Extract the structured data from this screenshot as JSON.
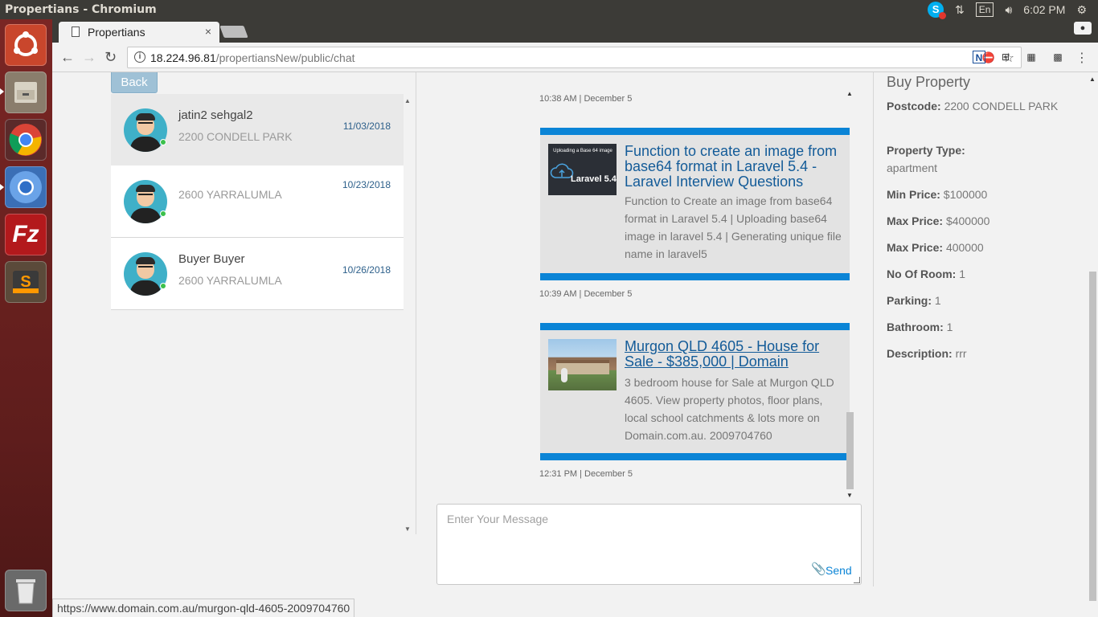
{
  "os": {
    "window_title": "Propertians - Chromium",
    "lang": "En",
    "clock": "6:02 PM",
    "skype_letter": "S"
  },
  "browser": {
    "tab_title": "Propertians",
    "tab_close": "×",
    "url_host": "18.224.96.81",
    "url_path": "/propertiansNew/public/chat",
    "status_url": "https://www.domain.com.au/murgon-qld-4605-2009704760"
  },
  "icons": {
    "back": "←",
    "forward": "→",
    "reload": "↻",
    "star": "☆",
    "menu": "⋮",
    "clip": "📎"
  },
  "sidebar": {
    "back_label": "Back",
    "contacts": [
      {
        "name": "jatin2 sehgal2",
        "location": "2200 CONDELL PARK",
        "date": "11/03/2018",
        "active": true
      },
      {
        "name": "",
        "location": "2600 YARRALUMLA",
        "date": "10/23/2018",
        "active": false
      },
      {
        "name": "Buyer Buyer",
        "location": "2600 YARRALUMLA",
        "date": "10/26/2018",
        "active": false
      }
    ]
  },
  "chat": {
    "messages": [
      {
        "time": "10:38 AM | December 5"
      },
      {
        "time": "10:39 AM | December 5",
        "card": {
          "thumb_line1": "Uploading a Base 64 image",
          "thumb_line2": "Laravel 5.4",
          "title": "Function to create an image from base64 format in Laravel 5.4 - Laravel Interview Questions",
          "description": "Function to Create an image from base64 format in Laravel 5.4 | Uploading base64 image in laravel 5.4 | Generating unique file name in laravel5"
        }
      },
      {
        "time": "12:31 PM | December 5",
        "card": {
          "title": "Murgon QLD 4605 - House for Sale - $385,000 | Domain",
          "description": "3 bedroom house for Sale at Murgon QLD 4605. View property photos, floor plans, local school catchments & lots more on Domain.com.au. 2009704760"
        }
      }
    ],
    "composer_placeholder": "Enter Your Message",
    "send_label": "Send"
  },
  "property": {
    "heading": "Buy Property",
    "rows": [
      {
        "label": "Postcode:",
        "value": "2200 CONDELL PARK"
      },
      {
        "label": "Property Type:",
        "value": "apartment"
      },
      {
        "label": "Min Price:",
        "value": "$100000"
      },
      {
        "label": "Max Price:",
        "value": "$400000"
      },
      {
        "label": "Max Price:",
        "value": "400000"
      },
      {
        "label": "No Of Room:",
        "value": "1"
      },
      {
        "label": "Parking:",
        "value": "1"
      },
      {
        "label": "Bathroom:",
        "value": "1"
      },
      {
        "label": "Description:",
        "value": "rrr"
      }
    ]
  },
  "colors": {
    "accent_blue": "#0a84d6",
    "link_blue": "#135b98",
    "launcher_red": "#7a2624"
  }
}
